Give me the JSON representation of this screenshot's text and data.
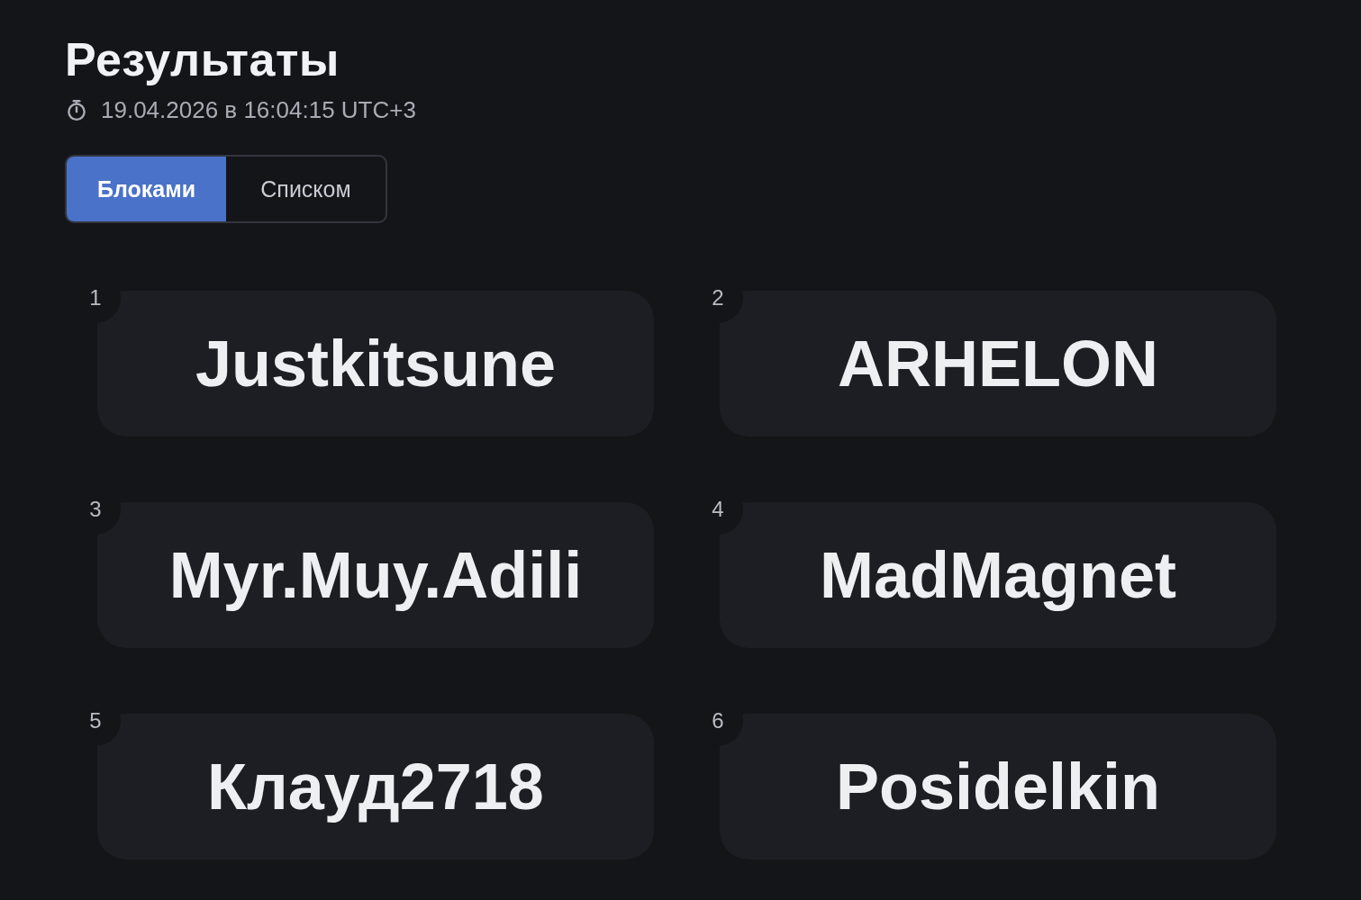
{
  "header": {
    "title": "Результаты",
    "timestamp": "19.04.2026 в 16:04:15 UTC+3"
  },
  "view_toggle": [
    {
      "label": "Блоками",
      "selected": true
    },
    {
      "label": "Списком",
      "selected": false
    }
  ],
  "results": [
    {
      "rank": "1",
      "name": "Justkitsune"
    },
    {
      "rank": "2",
      "name": "ARHELON"
    },
    {
      "rank": "3",
      "name": "Myr.Muy.Adili"
    },
    {
      "rank": "4",
      "name": "MadMagnet"
    },
    {
      "rank": "5",
      "name": "Клауд2718"
    },
    {
      "rank": "6",
      "name": "Posidelkin"
    }
  ]
}
